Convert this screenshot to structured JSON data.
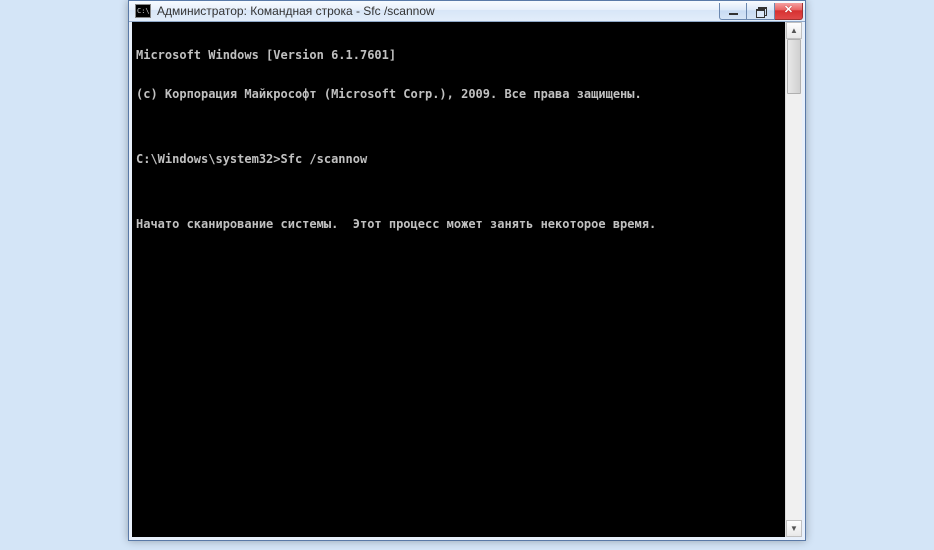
{
  "titlebar": {
    "icon_label": "C:\\",
    "title": "Администратор: Командная строка - Sfc  /scannow"
  },
  "controls": {
    "minimize_tip": "Minimize",
    "maximize_tip": "Maximize",
    "close_tip": "Close"
  },
  "console": {
    "lines": [
      "Microsoft Windows [Version 6.1.7601]",
      "(c) Корпорация Майкрософт (Microsoft Corp.), 2009. Все права защищены.",
      "",
      "C:\\Windows\\system32>Sfc /scannow",
      "",
      "Начато сканирование системы.  Этот процесс может занять некоторое время."
    ]
  }
}
